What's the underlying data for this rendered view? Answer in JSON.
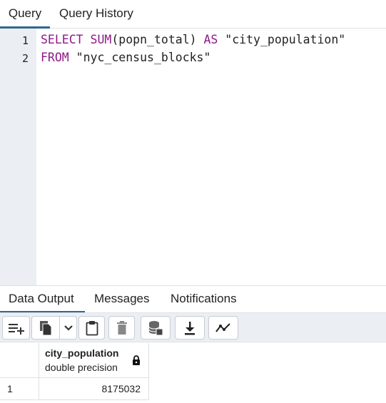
{
  "top_tabs": {
    "query": "Query",
    "history": "Query History"
  },
  "editor": {
    "lines": [
      {
        "number": "1",
        "tokens": [
          {
            "text": "SELECT ",
            "kind": "keyword"
          },
          {
            "text": "SUM",
            "kind": "keyword"
          },
          {
            "text": "(popn_total) ",
            "kind": "plain"
          },
          {
            "text": "AS",
            "kind": "keyword"
          },
          {
            "text": " \"city_population\"",
            "kind": "string"
          }
        ]
      },
      {
        "number": "2",
        "tokens": [
          {
            "text": "FROM",
            "kind": "keyword"
          },
          {
            "text": " \"nyc_census_blocks\"",
            "kind": "string"
          }
        ]
      }
    ],
    "keyword_color": "#8d1a88"
  },
  "bottom_tabs": {
    "data_output": "Data Output",
    "messages": "Messages",
    "notifications": "Notifications"
  },
  "toolbar": {
    "icons": [
      "add-row-icon",
      "copy-icon",
      "chevron-down-icon",
      "paste-icon",
      "delete-icon",
      "save-data-icon",
      "download-icon",
      "graph-icon"
    ]
  },
  "grid": {
    "columns": [
      {
        "name": "city_population",
        "type": "double precision",
        "locked": true
      }
    ],
    "rows": [
      {
        "row_number": "1",
        "values": [
          "8175032"
        ]
      }
    ]
  },
  "colors": {
    "accent": "#326690",
    "panel_bg": "#ebeef3",
    "border": "#dde0e6"
  }
}
